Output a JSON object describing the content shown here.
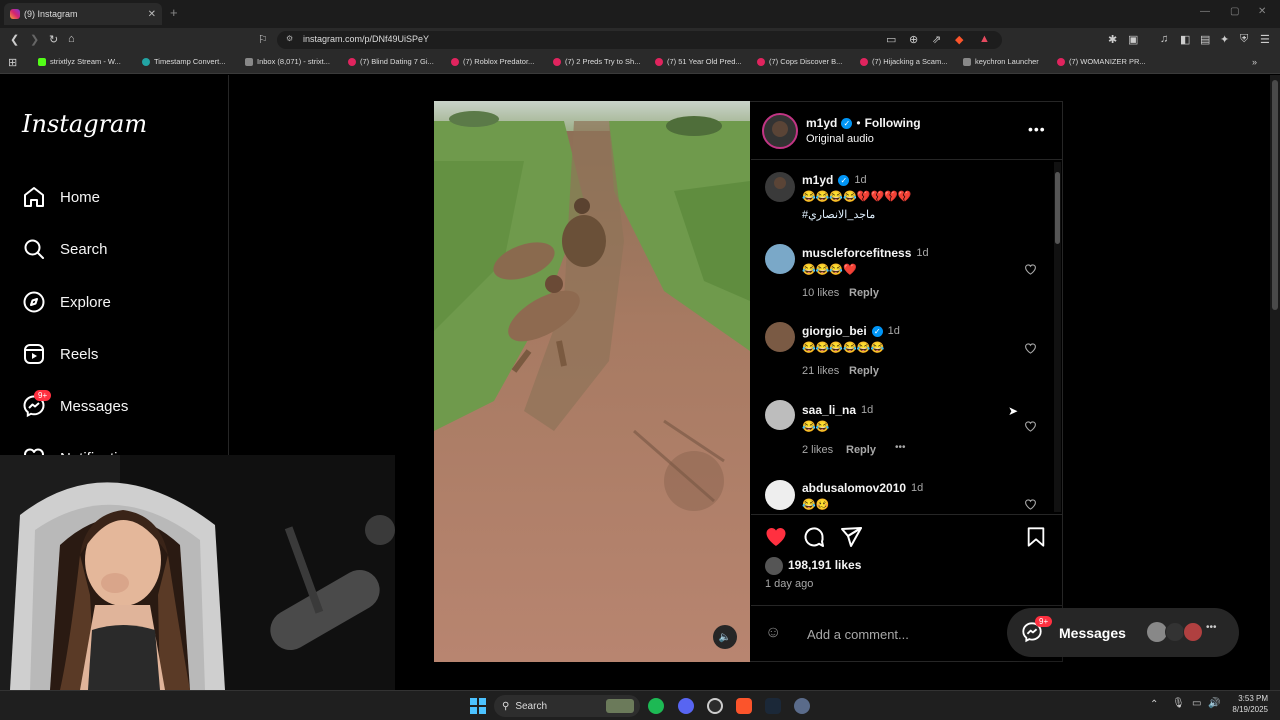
{
  "browser": {
    "tab_title": "(9) Instagram",
    "url": "instagram.com/p/DNf49UiSPeY",
    "bookmarks": [
      "strixtlyz Stream - W...",
      "Timestamp Convert...",
      "Inbox (8,071) - strixt...",
      "(7) Blind Dating 7 Gi...",
      "(7) Roblox Predator...",
      "(7) 2 Preds Try to Sh...",
      "(7) 51 Year Old Pred...",
      "(7) Cops Discover B...",
      "(7) Hijacking a Scam...",
      "keychron Launcher",
      "(7) WOMANIZER PR..."
    ]
  },
  "sidebar": {
    "logo": "Instagram",
    "items": [
      {
        "label": "Home",
        "icon": "home-icon"
      },
      {
        "label": "Search",
        "icon": "search-icon"
      },
      {
        "label": "Explore",
        "icon": "compass-icon"
      },
      {
        "label": "Reels",
        "icon": "reels-icon"
      },
      {
        "label": "Messages",
        "icon": "messenger-icon"
      },
      {
        "label": "Notifications",
        "icon": "heart-icon"
      }
    ],
    "messages_badge": "9+"
  },
  "post": {
    "author": "m1yd",
    "separator": "•",
    "follow_status": "Following",
    "audio": "Original audio",
    "caption": {
      "user": "m1yd",
      "time": "1d",
      "emojis": "😂😂😂😂💔💔💔💔",
      "hashtag": "#ماجد_الانصاري"
    },
    "comments": [
      {
        "user": "muscleforcefitness",
        "time": "1d",
        "text": "😂😂😂❤️",
        "likes": "10 likes",
        "reply": "Reply"
      },
      {
        "user": "giorgio_bei",
        "time": "1d",
        "text": "😂😂😂😂😂😂",
        "likes": "21 likes",
        "reply": "Reply"
      },
      {
        "user": "saa_li_na",
        "time": "1d",
        "text": "😂😂",
        "likes": "2 likes",
        "reply": "Reply"
      },
      {
        "user": "abdusalomov2010",
        "time": "1d",
        "text": "😂🥴",
        "likes": "",
        "reply": ""
      }
    ],
    "likes": "198,191 likes",
    "posted": "1 day ago",
    "comment_placeholder": "Add a comment..."
  },
  "messages_pill": {
    "label": "Messages",
    "badge": "9+"
  },
  "taskbar": {
    "search": "Search",
    "time": "3:53 PM",
    "date": "8/19/2025"
  }
}
